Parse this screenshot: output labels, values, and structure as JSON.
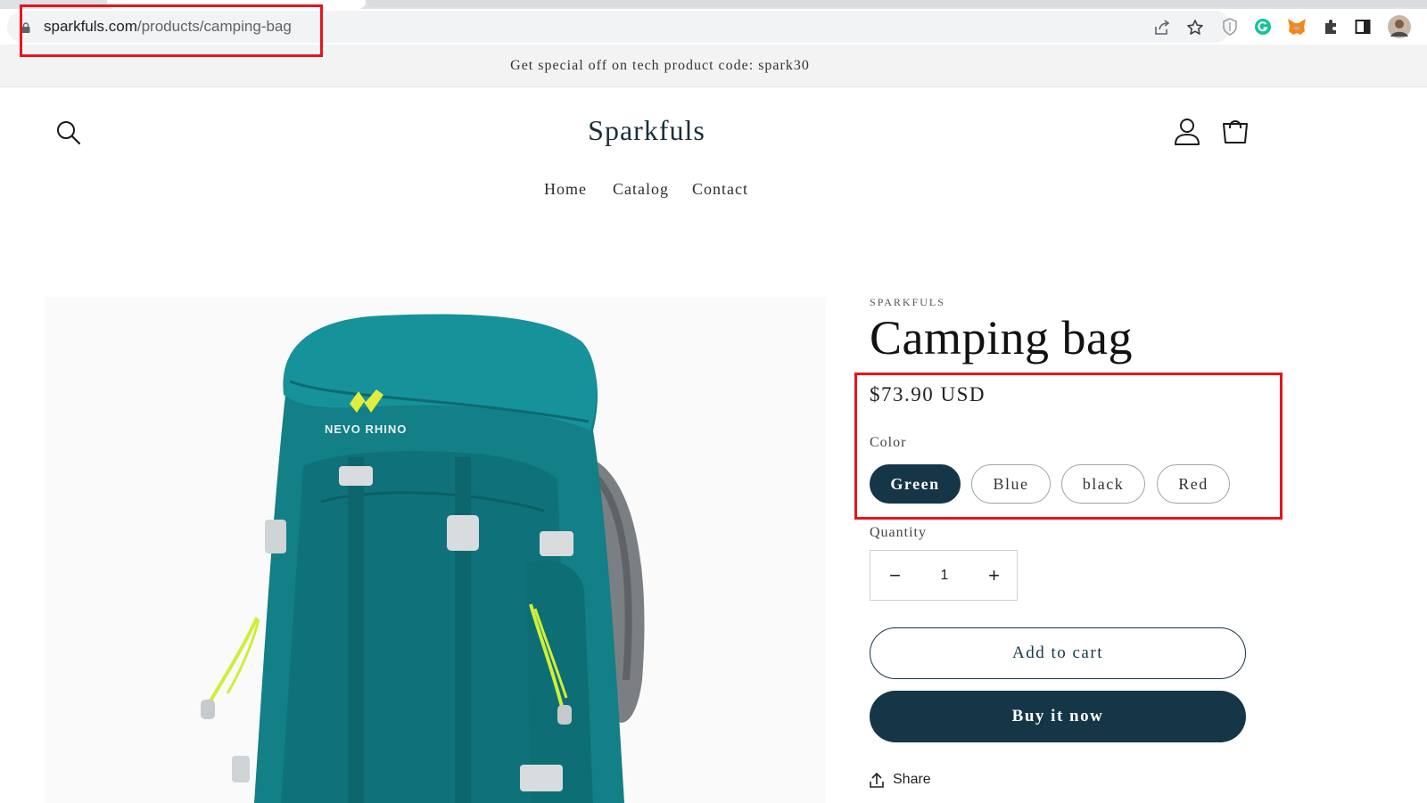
{
  "browser": {
    "url_host": "sparkfuls.com",
    "url_path": "/products/camping-bag",
    "icons": [
      "share-page-icon",
      "bookmark-star-icon",
      "shield-extension-icon",
      "grammarly-icon",
      "metamask-icon",
      "extensions-puzzle-icon",
      "side-panel-icon",
      "profile-avatar"
    ]
  },
  "announcement": "Get special off on tech product code: spark30",
  "header": {
    "logo": "Sparkfuls",
    "nav": [
      "Home",
      "Catalog",
      "Contact"
    ]
  },
  "product": {
    "vendor": "SPARKFULS",
    "title": "Camping bag",
    "price": "$73.90 USD",
    "color_label": "Color",
    "colors": [
      "Green",
      "Blue",
      "black",
      "Red"
    ],
    "selected_color": "Green",
    "quantity_label": "Quantity",
    "quantity": "1",
    "decrease": "−",
    "increase": "+",
    "add_to_cart": "Add to cart",
    "buy_now": "Buy it now",
    "share": "Share",
    "image_brand": "NEVO RHINO"
  },
  "colors": {
    "primary": "#153646",
    "annotation": "#e8141c",
    "bag": "#137f86"
  }
}
